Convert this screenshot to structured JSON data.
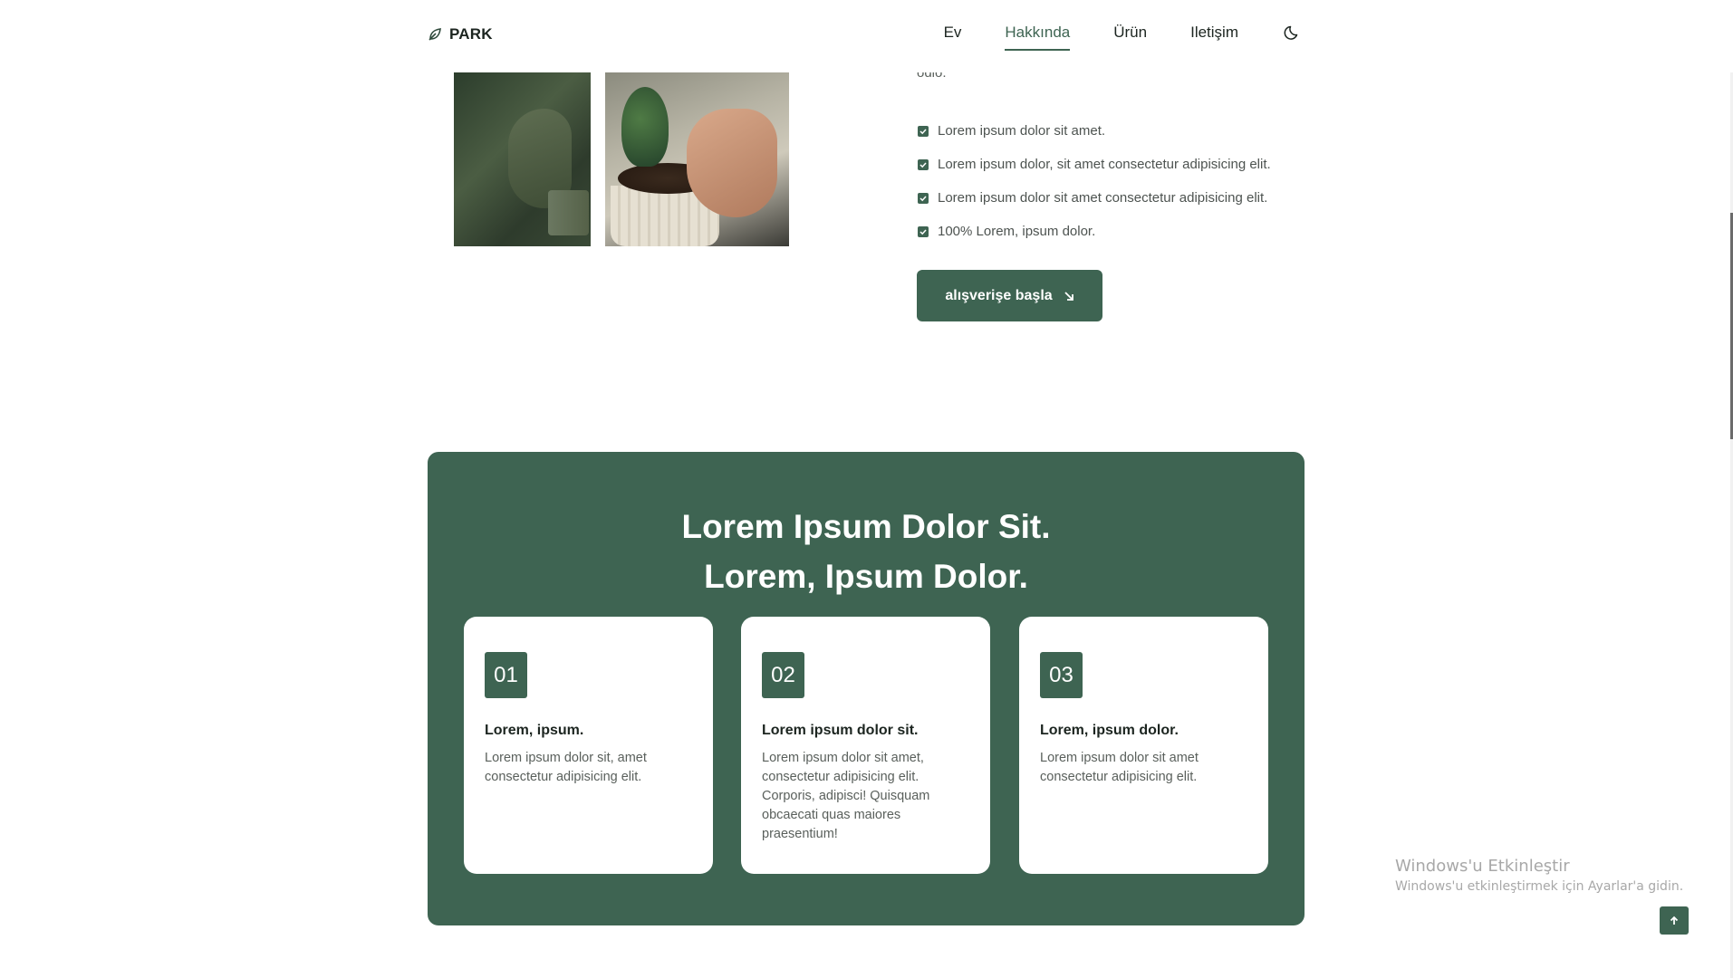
{
  "header": {
    "brand": "PARK",
    "logo_icon": "leaf-icon",
    "nav": [
      {
        "label": "Ev",
        "active": false
      },
      {
        "label": "Hakkında",
        "active": true
      },
      {
        "label": "Ürün",
        "active": false
      },
      {
        "label": "Iletişim",
        "active": false
      }
    ],
    "theme_icon": "moon-icon"
  },
  "about": {
    "partial_text": "odio.",
    "checklist": [
      "Lorem ipsum dolor sit amet.",
      "Lorem ipsum dolor, sit amet consectetur adipisicing elit.",
      "Lorem ipsum dolor sit amet consectetur adipisicing elit.",
      "100% Lorem, ipsum dolor."
    ],
    "cta_label": "alışverişe başla",
    "cta_icon": "arrow-down-right-icon"
  },
  "steps": {
    "title_line1": "Lorem Ipsum Dolor Sit.",
    "title_line2": "Lorem, Ipsum Dolor.",
    "cards": [
      {
        "number": "01",
        "title": "Lorem, ipsum.",
        "text": "Lorem ipsum dolor sit, amet consectetur adipisicing elit."
      },
      {
        "number": "02",
        "title": "Lorem ipsum dolor sit.",
        "text": "Lorem ipsum dolor sit amet, consectetur adipisicing elit. Corporis, adipisci! Quisquam obcaecati quas maiores praesentium!"
      },
      {
        "number": "03",
        "title": "Lorem, ipsum dolor.",
        "text": "Lorem ipsum dolor sit amet consectetur adipisicing elit."
      }
    ]
  },
  "watermark": {
    "title": "Windows'u Etkinleştir",
    "subtitle": "Windows'u etkinleştirmek için Ayarlar'a gidin."
  },
  "scroll_top_icon": "arrow-up-icon",
  "colors": {
    "accent": "#3e6452",
    "background": "#ffffff",
    "text": "#1c2520"
  }
}
